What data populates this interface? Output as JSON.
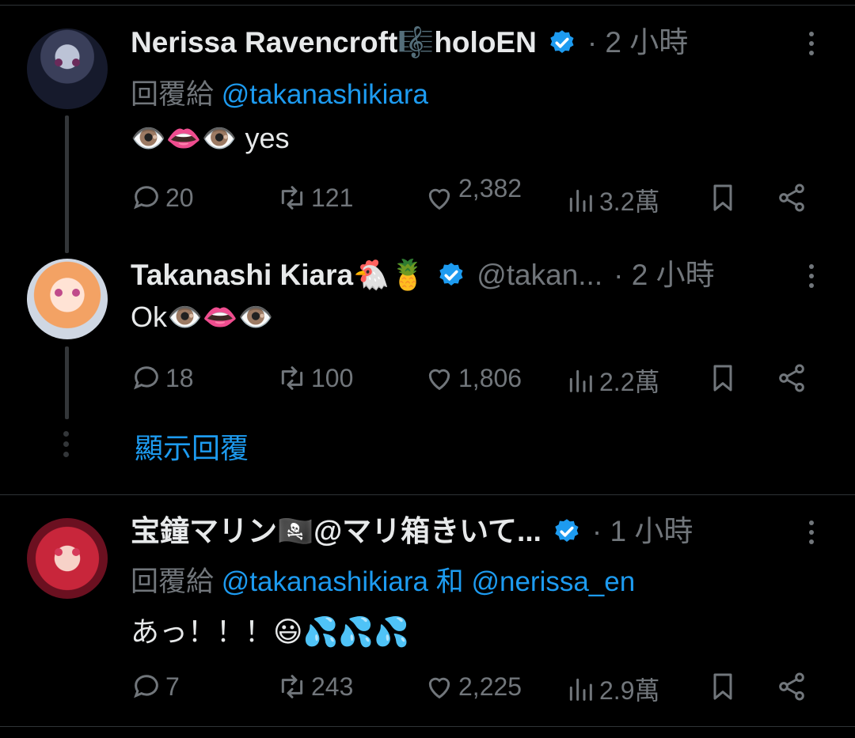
{
  "posts": [
    {
      "name": "Nerissa Ravencroft🎼holoEN",
      "handle": "",
      "time": "· 2 小時",
      "reply_prefix": "回覆給",
      "reply_to": "@takanashikiara",
      "reply_join": "",
      "reply_to2": "",
      "text": "👁️👄👁️ yes",
      "replies": "20",
      "reposts": "121",
      "likes": "2,382",
      "views": "3.2萬"
    },
    {
      "name": "Takanashi Kiara🐔🍍",
      "handle": "@takan...",
      "time": "· 2 小時",
      "text": "Ok👁️👄👁️",
      "replies": "18",
      "reposts": "100",
      "likes": "1,806",
      "views": "2.2萬"
    },
    {
      "name": "宝鐘マリン🏴‍☠️@マリ箱きいて...",
      "handle": "",
      "time": "· 1 小時",
      "reply_prefix": "回覆給",
      "reply_to": "@takanashikiara",
      "reply_join": "和",
      "reply_to2": "@nerissa_en",
      "text": "あっ！！！😃💦💦💦",
      "replies": "7",
      "reposts": "243",
      "likes": "2,225",
      "views": "2.9萬"
    }
  ],
  "show_replies": "顯示回覆",
  "icons": {
    "verified": "verified-badge-icon",
    "more": "more-options-icon",
    "reply": "reply-icon",
    "repost": "repost-icon",
    "like": "like-icon",
    "views": "views-icon",
    "bookmark": "bookmark-icon",
    "share": "share-icon"
  },
  "colors": {
    "background": "#000000",
    "text": "#e7e9ea",
    "muted": "#71767b",
    "accent": "#1d9bf0"
  }
}
